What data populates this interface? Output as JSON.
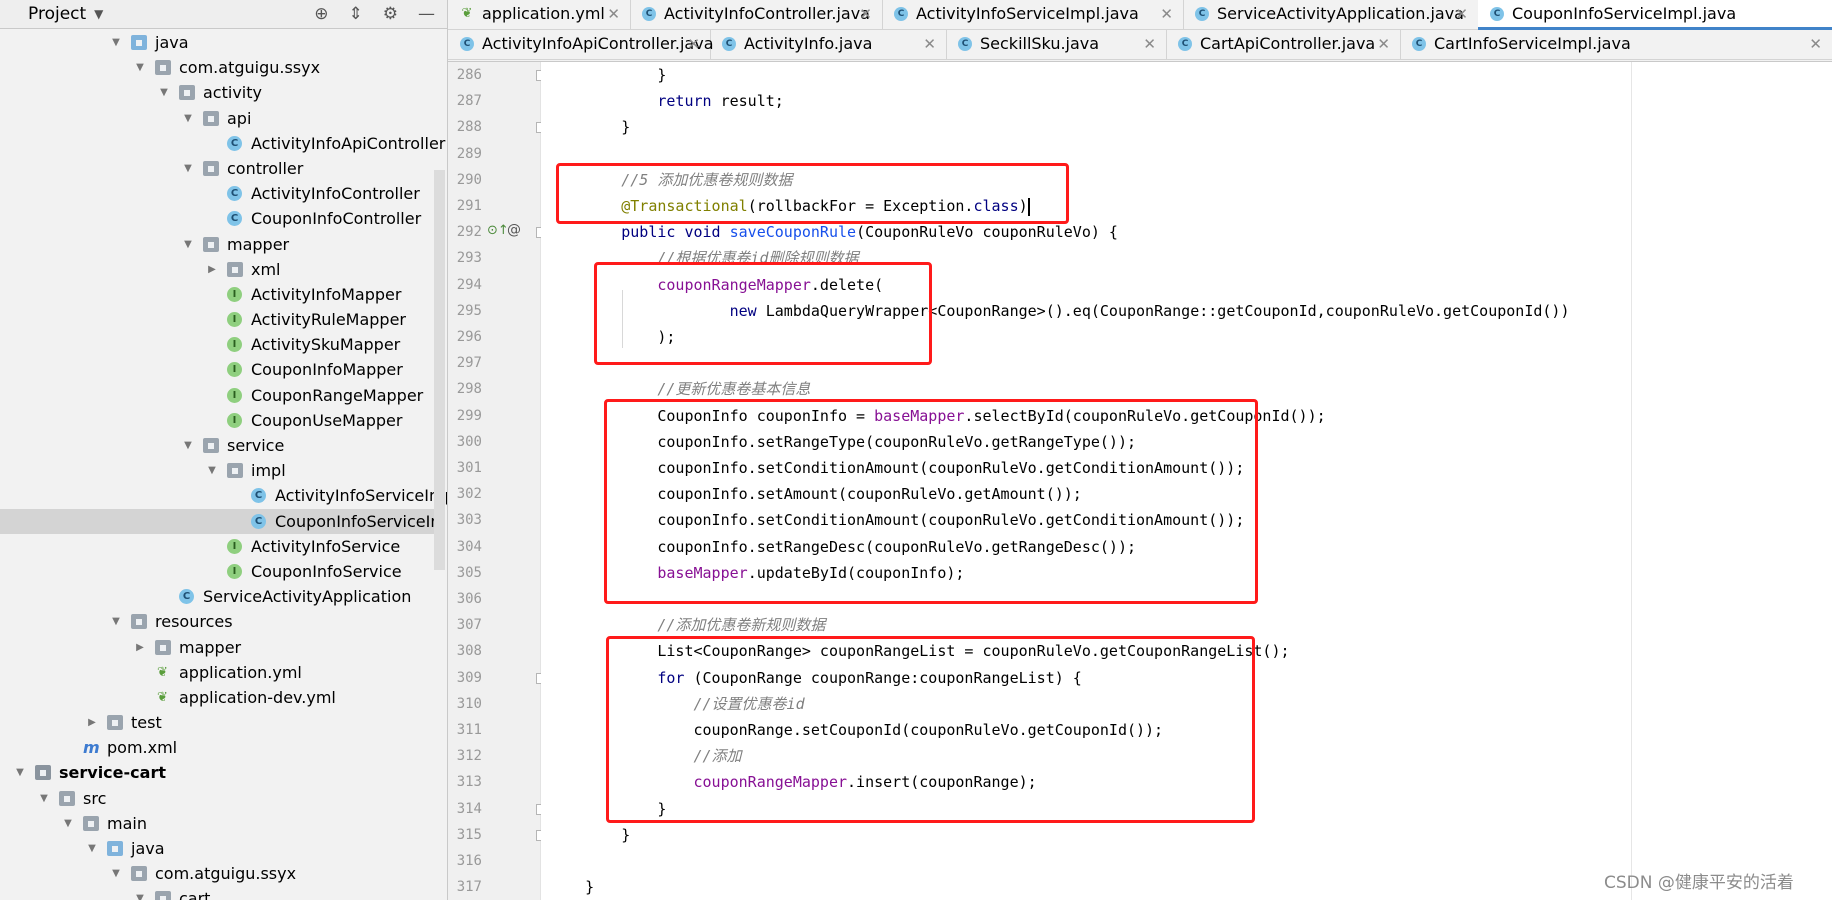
{
  "project_panel": {
    "title": "Project",
    "tree": [
      {
        "label": "java",
        "icon": "folder-blue-icon",
        "indent": 0,
        "arrow": "down"
      },
      {
        "label": "com.atguigu.ssyx",
        "icon": "package-icon",
        "indent": 1,
        "arrow": "down"
      },
      {
        "label": "activity",
        "icon": "package-icon",
        "indent": 2,
        "arrow": "down"
      },
      {
        "label": "api",
        "icon": "package-icon",
        "indent": 3,
        "arrow": "down"
      },
      {
        "label": "ActivityInfoApiController",
        "icon": "class-icon",
        "indent": 4,
        "arrow": ""
      },
      {
        "label": "controller",
        "icon": "package-icon",
        "indent": 3,
        "arrow": "down"
      },
      {
        "label": "ActivityInfoController",
        "icon": "class-icon",
        "indent": 4,
        "arrow": ""
      },
      {
        "label": "CouponInfoController",
        "icon": "class-icon",
        "indent": 4,
        "arrow": ""
      },
      {
        "label": "mapper",
        "icon": "package-icon",
        "indent": 3,
        "arrow": "down"
      },
      {
        "label": "xml",
        "icon": "package-icon",
        "indent": 4,
        "arrow": "right"
      },
      {
        "label": "ActivityInfoMapper",
        "icon": "interface-icon",
        "indent": 4,
        "arrow": ""
      },
      {
        "label": "ActivityRuleMapper",
        "icon": "interface-icon",
        "indent": 4,
        "arrow": ""
      },
      {
        "label": "ActivitySkuMapper",
        "icon": "interface-icon",
        "indent": 4,
        "arrow": ""
      },
      {
        "label": "CouponInfoMapper",
        "icon": "interface-icon",
        "indent": 4,
        "arrow": ""
      },
      {
        "label": "CouponRangeMapper",
        "icon": "interface-icon",
        "indent": 4,
        "arrow": ""
      },
      {
        "label": "CouponUseMapper",
        "icon": "interface-icon",
        "indent": 4,
        "arrow": ""
      },
      {
        "label": "service",
        "icon": "package-icon",
        "indent": 3,
        "arrow": "down"
      },
      {
        "label": "impl",
        "icon": "package-icon",
        "indent": 4,
        "arrow": "down"
      },
      {
        "label": "ActivityInfoServiceImpl",
        "icon": "class-icon",
        "indent": 5,
        "arrow": ""
      },
      {
        "label": "CouponInfoServiceImpl",
        "icon": "class-icon",
        "indent": 5,
        "arrow": "",
        "selected": true
      },
      {
        "label": "ActivityInfoService",
        "icon": "interface-icon",
        "indent": 4,
        "arrow": ""
      },
      {
        "label": "CouponInfoService",
        "icon": "interface-icon",
        "indent": 4,
        "arrow": ""
      },
      {
        "label": "ServiceActivityApplication",
        "icon": "spring-class-icon",
        "indent": 2,
        "arrow": ""
      },
      {
        "label": "resources",
        "icon": "resources-folder-icon",
        "indent": 0,
        "arrow": "down"
      },
      {
        "label": "mapper",
        "icon": "folder-icon",
        "indent": 1,
        "arrow": "right"
      },
      {
        "label": "application.yml",
        "icon": "spring-leaf-icon",
        "indent": 1,
        "arrow": ""
      },
      {
        "label": "application-dev.yml",
        "icon": "spring-leaf-icon",
        "indent": 1,
        "arrow": ""
      },
      {
        "label": "test",
        "icon": "folder-icon",
        "indent": -1,
        "arrow": "right"
      },
      {
        "label": "pom.xml",
        "icon": "maven-icon",
        "indent": -2,
        "arrow": ""
      },
      {
        "label": "service-cart",
        "icon": "module-icon",
        "indent": -4,
        "arrow": "down",
        "bold": true
      },
      {
        "label": "src",
        "icon": "folder-icon",
        "indent": -3,
        "arrow": "down"
      },
      {
        "label": "main",
        "icon": "folder-icon",
        "indent": -2,
        "arrow": "down"
      },
      {
        "label": "java",
        "icon": "folder-blue-icon",
        "indent": -1,
        "arrow": "down"
      },
      {
        "label": "com.atguigu.ssyx",
        "icon": "package-icon",
        "indent": 0,
        "arrow": "down"
      },
      {
        "label": "cart",
        "icon": "package-icon",
        "indent": 1,
        "arrow": "down"
      }
    ]
  },
  "tabs": {
    "row1": [
      {
        "label": "application.yml",
        "icon": "spring-leaf-icon",
        "active": false
      },
      {
        "label": "ActivityInfoController.java",
        "icon": "class-icon",
        "active": false
      },
      {
        "label": "ActivityInfoServiceImpl.java",
        "icon": "class-icon",
        "active": false
      },
      {
        "label": "ServiceActivityApplication.java",
        "icon": "spring-class-icon",
        "active": false
      },
      {
        "label": "CouponInfoServiceImpl.java",
        "icon": "class-icon",
        "active": true
      }
    ],
    "row2": [
      {
        "label": "ActivityInfoApiController.java",
        "icon": "class-icon",
        "active": false
      },
      {
        "label": "ActivityInfo.java",
        "icon": "class-icon",
        "active": false
      },
      {
        "label": "SeckillSku.java",
        "icon": "class-icon",
        "active": false
      },
      {
        "label": "CartApiController.java",
        "icon": "class-icon",
        "active": false
      },
      {
        "label": "CartInfoServiceImpl.java",
        "icon": "class-icon",
        "active": false
      }
    ]
  },
  "editor": {
    "line_numbers": [
      "286",
      "287",
      "288",
      "289",
      "290",
      "291",
      "292",
      "293",
      "294",
      "295",
      "296",
      "297",
      "298",
      "299",
      "300",
      "301",
      "302",
      "303",
      "304",
      "305",
      "306",
      "307",
      "308",
      "309",
      "310",
      "311",
      "312",
      "313",
      "314",
      "315",
      "316",
      "317"
    ],
    "lines": [
      [
        {
          "t": "            }"
        }
      ],
      [
        {
          "t": "            "
        },
        {
          "t": "return",
          "c": "kw"
        },
        {
          "t": " result;"
        }
      ],
      [
        {
          "t": "        }"
        }
      ],
      [
        {
          "t": ""
        }
      ],
      [
        {
          "t": "        "
        },
        {
          "t": "//5 添加优惠卷规则数据",
          "c": "cm"
        }
      ],
      [
        {
          "t": "        "
        },
        {
          "t": "@Transactional",
          "c": "ann"
        },
        {
          "t": "(rollbackFor = Exception."
        },
        {
          "t": "class",
          "c": "kw"
        },
        {
          "t": ")"
        }
      ],
      [
        {
          "t": "        "
        },
        {
          "t": "public void",
          "c": "kw"
        },
        {
          "t": " "
        },
        {
          "t": "saveCouponRule",
          "c": "mth"
        },
        {
          "t": "(CouponRuleVo couponRuleVo) {"
        }
      ],
      [
        {
          "t": "            "
        },
        {
          "t": "//根据优惠卷id删除规则数据",
          "c": "cm"
        }
      ],
      [
        {
          "t": "            "
        },
        {
          "t": "couponRangeMapper",
          "c": "fld"
        },
        {
          "t": ".delete("
        }
      ],
      [
        {
          "t": "                    "
        },
        {
          "t": "new",
          "c": "kw"
        },
        {
          "t": " LambdaQueryWrapper<CouponRange>().eq(CouponRange::getCouponId,couponRuleVo.getCouponId())"
        }
      ],
      [
        {
          "t": "            );"
        }
      ],
      [
        {
          "t": ""
        }
      ],
      [
        {
          "t": "            "
        },
        {
          "t": "//更新优惠卷基本信息",
          "c": "cm"
        }
      ],
      [
        {
          "t": "            CouponInfo couponInfo = "
        },
        {
          "t": "baseMapper",
          "c": "fld"
        },
        {
          "t": ".selectById(couponRuleVo.getCouponId());"
        }
      ],
      [
        {
          "t": "            couponInfo.setRangeType(couponRuleVo.getRangeType());"
        }
      ],
      [
        {
          "t": "            couponInfo.setConditionAmount(couponRuleVo.getConditionAmount());"
        }
      ],
      [
        {
          "t": "            couponInfo.setAmount(couponRuleVo.getAmount());"
        }
      ],
      [
        {
          "t": "            couponInfo.setConditionAmount(couponRuleVo.getConditionAmount());"
        }
      ],
      [
        {
          "t": "            couponInfo.setRangeDesc(couponRuleVo.getRangeDesc());"
        }
      ],
      [
        {
          "t": "            "
        },
        {
          "t": "baseMapper",
          "c": "fld"
        },
        {
          "t": ".updateById(couponInfo);"
        }
      ],
      [
        {
          "t": ""
        }
      ],
      [
        {
          "t": "            "
        },
        {
          "t": "//添加优惠卷新规则数据",
          "c": "cm"
        }
      ],
      [
        {
          "t": "            List<CouponRange> couponRangeList = couponRuleVo.getCouponRangeList();"
        }
      ],
      [
        {
          "t": "            "
        },
        {
          "t": "for",
          "c": "kw"
        },
        {
          "t": " (CouponRange couponRange:couponRangeList) {"
        }
      ],
      [
        {
          "t": "                "
        },
        {
          "t": "//设置优惠卷id",
          "c": "cm"
        }
      ],
      [
        {
          "t": "                couponRange.setCouponId(couponRuleVo.getCouponId());"
        }
      ],
      [
        {
          "t": "                "
        },
        {
          "t": "//添加",
          "c": "cm"
        }
      ],
      [
        {
          "t": "                "
        },
        {
          "t": "couponRangeMapper",
          "c": "fld"
        },
        {
          "t": ".insert(couponRange);"
        }
      ],
      [
        {
          "t": "            }"
        }
      ],
      [
        {
          "t": "        }"
        }
      ],
      [
        {
          "t": ""
        }
      ],
      [
        {
          "t": "    }"
        }
      ]
    ]
  },
  "colors": {
    "keyword": "#000080",
    "comment": "#808080",
    "field": "#871094",
    "annotation": "#808000",
    "method": "#1750eb",
    "highlight_box": "#ff1a1a",
    "active_tab_underline": "#4083c9"
  },
  "watermark": "CSDN @健康平安的活着"
}
